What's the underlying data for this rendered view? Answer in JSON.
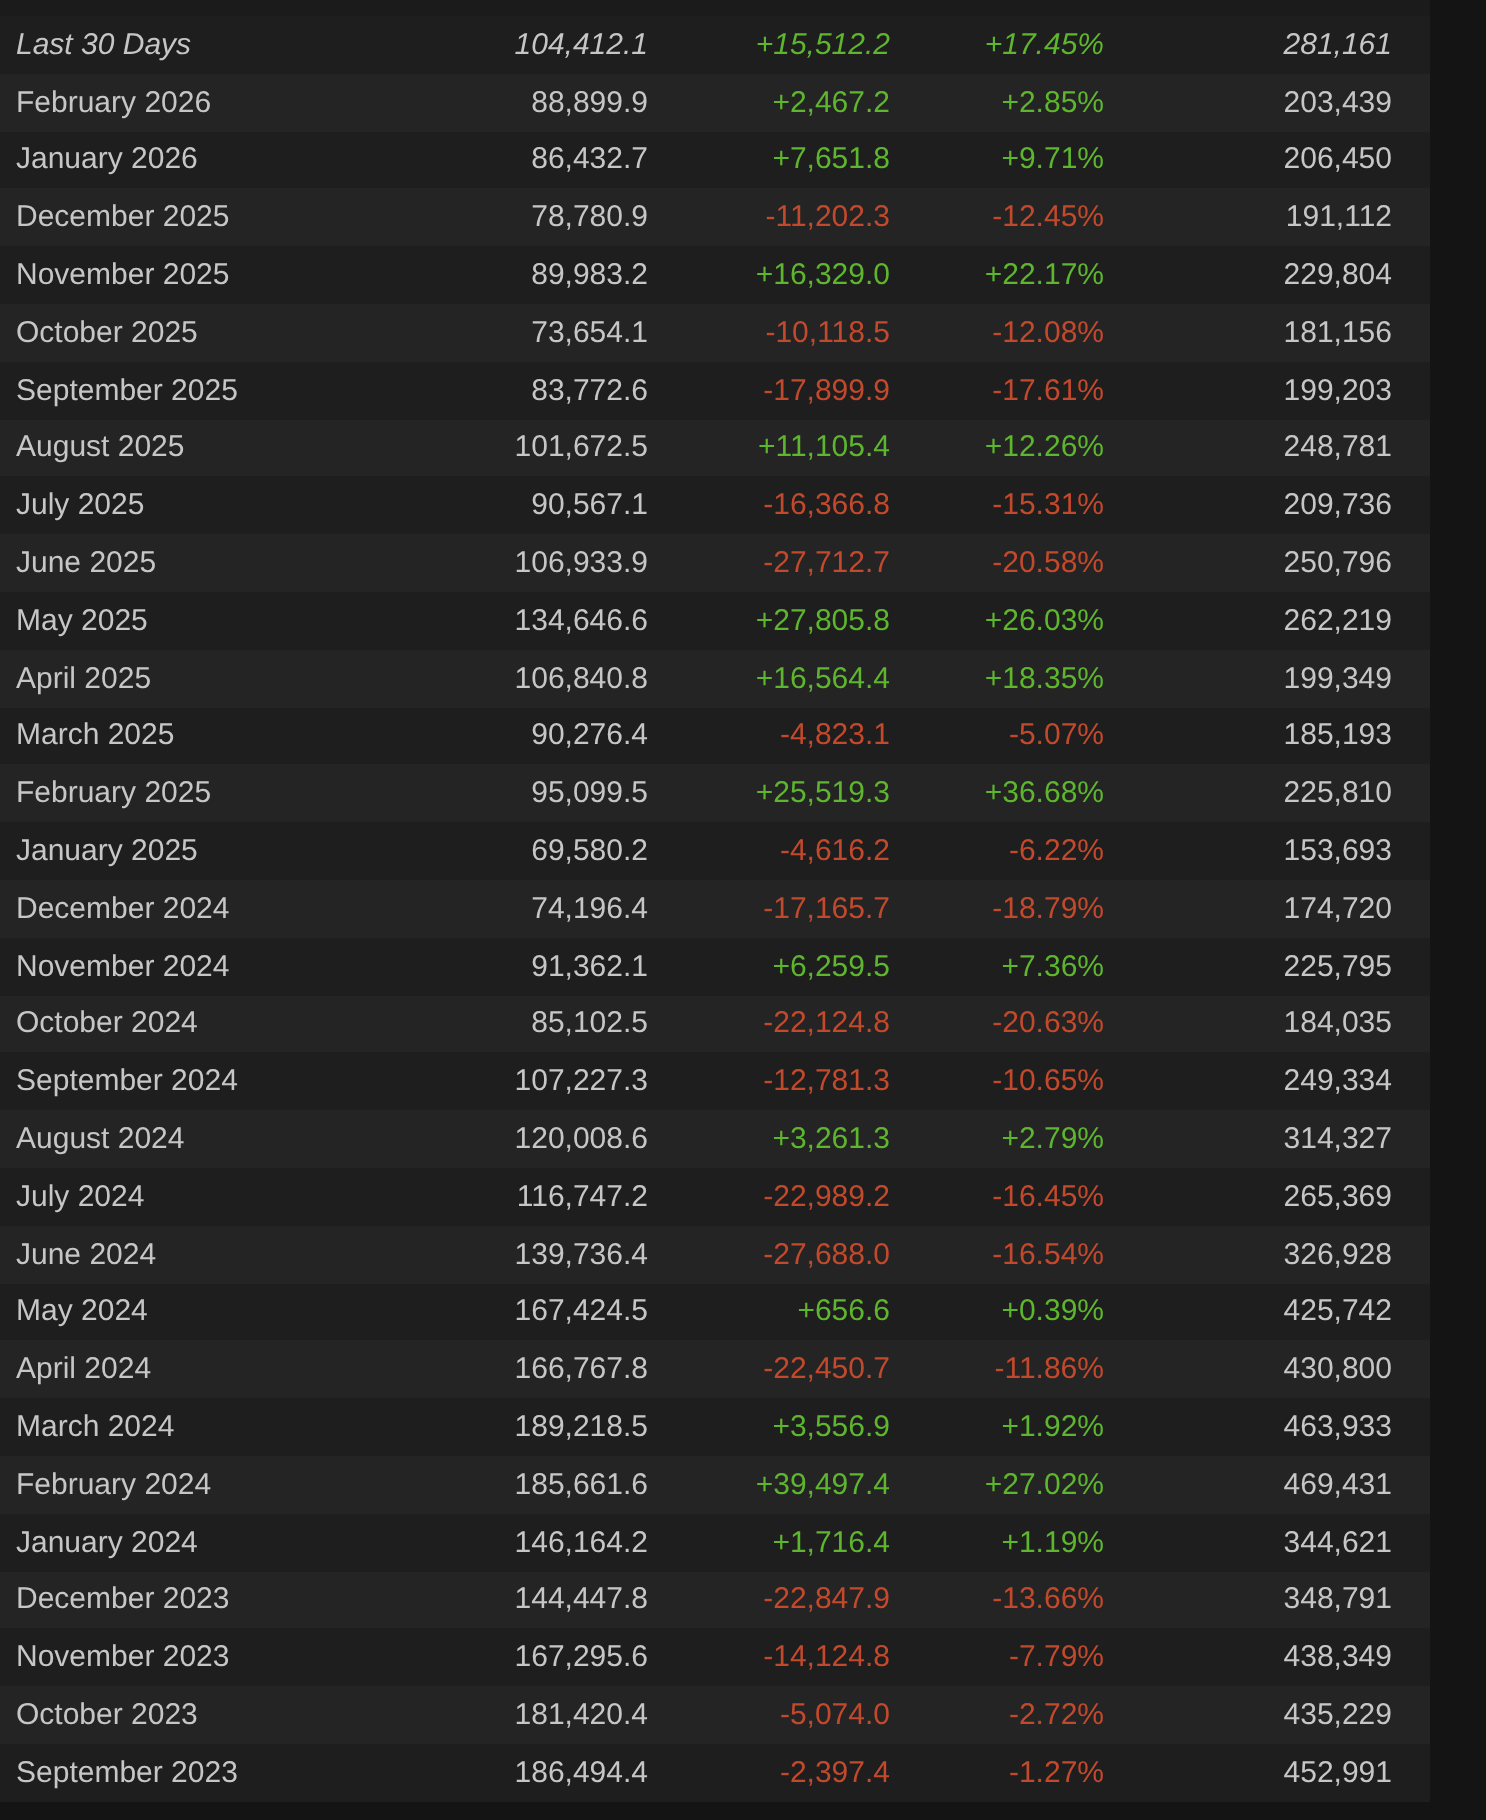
{
  "rows": [
    {
      "kind": "summary",
      "month": "Last 30 Days",
      "avg_players": "104,412.1",
      "gain": "+15,512.2",
      "percent_gain": "+17.45%",
      "peak_players": "281,161",
      "positive": true
    },
    {
      "kind": "month",
      "month": "February 2026",
      "avg_players": "88,899.9",
      "gain": "+2,467.2",
      "percent_gain": "+2.85%",
      "peak_players": "203,439",
      "positive": true
    },
    {
      "kind": "month",
      "month": "January 2026",
      "avg_players": "86,432.7",
      "gain": "+7,651.8",
      "percent_gain": "+9.71%",
      "peak_players": "206,450",
      "positive": true
    },
    {
      "kind": "month",
      "month": "December 2025",
      "avg_players": "78,780.9",
      "gain": "-11,202.3",
      "percent_gain": "-12.45%",
      "peak_players": "191,112",
      "positive": false
    },
    {
      "kind": "month",
      "month": "November 2025",
      "avg_players": "89,983.2",
      "gain": "+16,329.0",
      "percent_gain": "+22.17%",
      "peak_players": "229,804",
      "positive": true
    },
    {
      "kind": "month",
      "month": "October 2025",
      "avg_players": "73,654.1",
      "gain": "-10,118.5",
      "percent_gain": "-12.08%",
      "peak_players": "181,156",
      "positive": false
    },
    {
      "kind": "month",
      "month": "September 2025",
      "avg_players": "83,772.6",
      "gain": "-17,899.9",
      "percent_gain": "-17.61%",
      "peak_players": "199,203",
      "positive": false
    },
    {
      "kind": "month",
      "month": "August 2025",
      "avg_players": "101,672.5",
      "gain": "+11,105.4",
      "percent_gain": "+12.26%",
      "peak_players": "248,781",
      "positive": true
    },
    {
      "kind": "month",
      "month": "July 2025",
      "avg_players": "90,567.1",
      "gain": "-16,366.8",
      "percent_gain": "-15.31%",
      "peak_players": "209,736",
      "positive": false
    },
    {
      "kind": "month",
      "month": "June 2025",
      "avg_players": "106,933.9",
      "gain": "-27,712.7",
      "percent_gain": "-20.58%",
      "peak_players": "250,796",
      "positive": false
    },
    {
      "kind": "month",
      "month": "May 2025",
      "avg_players": "134,646.6",
      "gain": "+27,805.8",
      "percent_gain": "+26.03%",
      "peak_players": "262,219",
      "positive": true
    },
    {
      "kind": "month",
      "month": "April 2025",
      "avg_players": "106,840.8",
      "gain": "+16,564.4",
      "percent_gain": "+18.35%",
      "peak_players": "199,349",
      "positive": true
    },
    {
      "kind": "month",
      "month": "March 2025",
      "avg_players": "90,276.4",
      "gain": "-4,823.1",
      "percent_gain": "-5.07%",
      "peak_players": "185,193",
      "positive": false
    },
    {
      "kind": "month",
      "month": "February 2025",
      "avg_players": "95,099.5",
      "gain": "+25,519.3",
      "percent_gain": "+36.68%",
      "peak_players": "225,810",
      "positive": true
    },
    {
      "kind": "month",
      "month": "January 2025",
      "avg_players": "69,580.2",
      "gain": "-4,616.2",
      "percent_gain": "-6.22%",
      "peak_players": "153,693",
      "positive": false
    },
    {
      "kind": "month",
      "month": "December 2024",
      "avg_players": "74,196.4",
      "gain": "-17,165.7",
      "percent_gain": "-18.79%",
      "peak_players": "174,720",
      "positive": false
    },
    {
      "kind": "month",
      "month": "November 2024",
      "avg_players": "91,362.1",
      "gain": "+6,259.5",
      "percent_gain": "+7.36%",
      "peak_players": "225,795",
      "positive": true
    },
    {
      "kind": "month",
      "month": "October 2024",
      "avg_players": "85,102.5",
      "gain": "-22,124.8",
      "percent_gain": "-20.63%",
      "peak_players": "184,035",
      "positive": false
    },
    {
      "kind": "month",
      "month": "September 2024",
      "avg_players": "107,227.3",
      "gain": "-12,781.3",
      "percent_gain": "-10.65%",
      "peak_players": "249,334",
      "positive": false
    },
    {
      "kind": "month",
      "month": "August 2024",
      "avg_players": "120,008.6",
      "gain": "+3,261.3",
      "percent_gain": "+2.79%",
      "peak_players": "314,327",
      "positive": true
    },
    {
      "kind": "month",
      "month": "July 2024",
      "avg_players": "116,747.2",
      "gain": "-22,989.2",
      "percent_gain": "-16.45%",
      "peak_players": "265,369",
      "positive": false
    },
    {
      "kind": "month",
      "month": "June 2024",
      "avg_players": "139,736.4",
      "gain": "-27,688.0",
      "percent_gain": "-16.54%",
      "peak_players": "326,928",
      "positive": false
    },
    {
      "kind": "month",
      "month": "May 2024",
      "avg_players": "167,424.5",
      "gain": "+656.6",
      "percent_gain": "+0.39%",
      "peak_players": "425,742",
      "positive": true
    },
    {
      "kind": "month",
      "month": "April 2024",
      "avg_players": "166,767.8",
      "gain": "-22,450.7",
      "percent_gain": "-11.86%",
      "peak_players": "430,800",
      "positive": false
    },
    {
      "kind": "month",
      "month": "March 2024",
      "avg_players": "189,218.5",
      "gain": "+3,556.9",
      "percent_gain": "+1.92%",
      "peak_players": "463,933",
      "positive": true
    },
    {
      "kind": "month",
      "month": "February 2024",
      "avg_players": "185,661.6",
      "gain": "+39,497.4",
      "percent_gain": "+27.02%",
      "peak_players": "469,431",
      "positive": true
    },
    {
      "kind": "month",
      "month": "January 2024",
      "avg_players": "146,164.2",
      "gain": "+1,716.4",
      "percent_gain": "+1.19%",
      "peak_players": "344,621",
      "positive": true
    },
    {
      "kind": "month",
      "month": "December 2023",
      "avg_players": "144,447.8",
      "gain": "-22,847.9",
      "percent_gain": "-13.66%",
      "peak_players": "348,791",
      "positive": false
    },
    {
      "kind": "month",
      "month": "November 2023",
      "avg_players": "167,295.6",
      "gain": "-14,124.8",
      "percent_gain": "-7.79%",
      "peak_players": "438,349",
      "positive": false
    },
    {
      "kind": "month",
      "month": "October 2023",
      "avg_players": "181,420.4",
      "gain": "-5,074.0",
      "percent_gain": "-2.72%",
      "peak_players": "435,229",
      "positive": false
    },
    {
      "kind": "month",
      "month": "September 2023",
      "avg_players": "186,494.4",
      "gain": "-2,397.4",
      "percent_gain": "-1.27%",
      "peak_players": "452,991",
      "positive": false
    }
  ]
}
